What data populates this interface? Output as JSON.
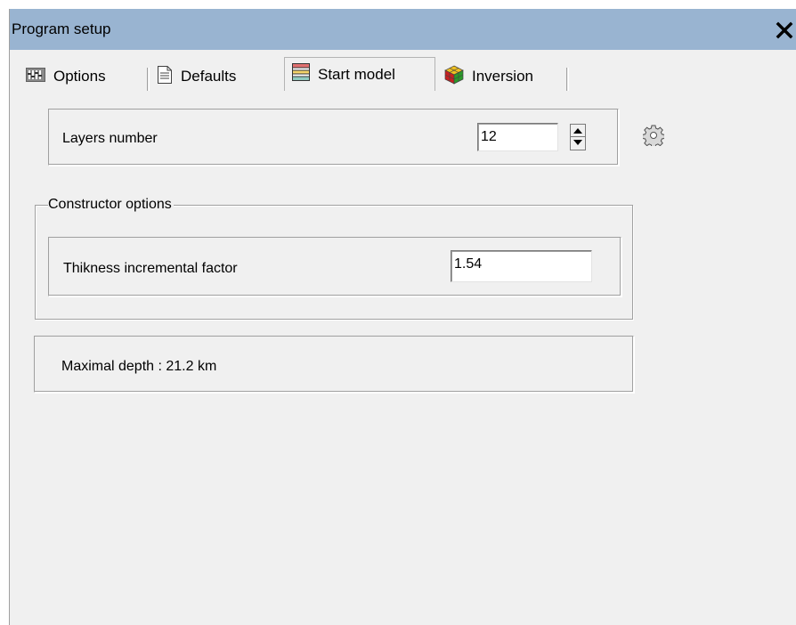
{
  "window": {
    "title": "Program setup",
    "close_label": "✕"
  },
  "tabs": [
    {
      "label": "Options",
      "icon": "equalizer-icon"
    },
    {
      "label": "Defaults",
      "icon": "document-icon"
    },
    {
      "label": "Start model",
      "icon": "layers-table-icon",
      "selected": true
    },
    {
      "label": "Inversion",
      "icon": "cube-icon"
    }
  ],
  "layers": {
    "label": "Layers number",
    "value": "12",
    "settings_icon": "gear-icon"
  },
  "constructor": {
    "caption": "Constructor options",
    "thickness_label": "Thikness incremental factor",
    "thickness_value": "1.54"
  },
  "depth": {
    "text": "Maximal depth : 21.2 km"
  },
  "colors": {
    "titlebar": "#99b4d1",
    "window_bg": "#f0f0f0"
  }
}
